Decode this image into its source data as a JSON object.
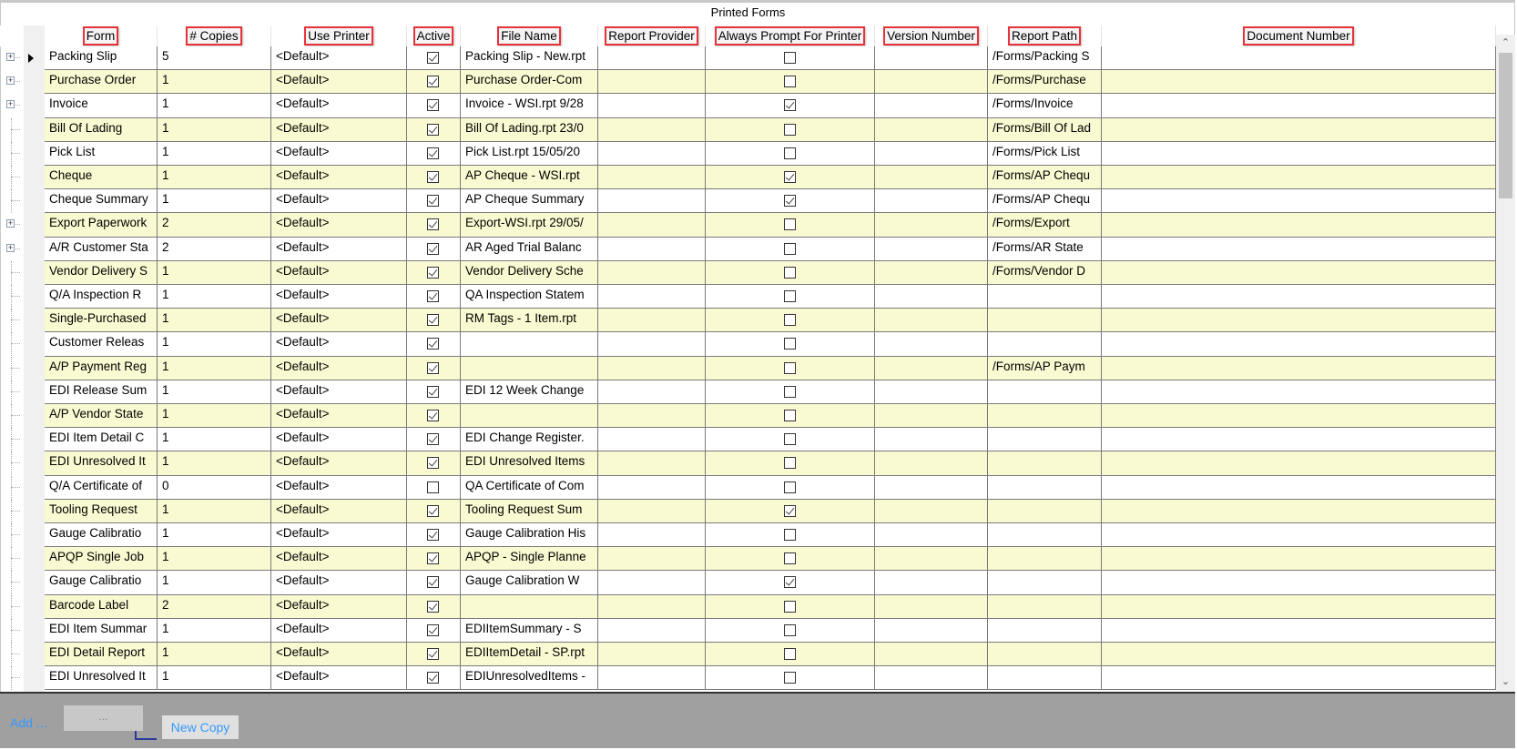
{
  "title": "Printed Forms",
  "columns": [
    "Form",
    "# Copies",
    "Use Printer",
    "Active",
    "File Name",
    "Report Provider",
    "Always Prompt For Printer",
    "Version Number",
    "Report Path",
    "Document Number"
  ],
  "colors": {
    "alt_row": "#fafad2",
    "header_highlight": "#e8323a",
    "link": "#3399ff",
    "footer": "#a0a0a0"
  },
  "rows": [
    {
      "form": "Packing Slip",
      "copies": "5",
      "printer": "<Default>",
      "active": true,
      "file": "Packing Slip - New.rpt",
      "provider": "",
      "prompt": false,
      "version": "",
      "path": "/Forms/Packing S",
      "doc": "",
      "expandable": true,
      "current": true
    },
    {
      "form": "Purchase Order",
      "copies": "1",
      "printer": "<Default>",
      "active": true,
      "file": "Purchase Order-Com",
      "provider": "",
      "prompt": false,
      "version": "",
      "path": "/Forms/Purchase",
      "doc": "",
      "expandable": true
    },
    {
      "form": "Invoice",
      "copies": "1",
      "printer": "<Default>",
      "active": true,
      "file": "Invoice - WSI.rpt 9/28",
      "provider": "",
      "prompt": true,
      "version": "",
      "path": "/Forms/Invoice",
      "doc": "",
      "expandable": true
    },
    {
      "form": "Bill Of Lading",
      "copies": "1",
      "printer": "<Default>",
      "active": true,
      "file": "Bill Of Lading.rpt 23/0",
      "provider": "",
      "prompt": false,
      "version": "",
      "path": "/Forms/Bill Of Lad",
      "doc": ""
    },
    {
      "form": "Pick List",
      "copies": "1",
      "printer": "<Default>",
      "active": true,
      "file": "Pick List.rpt 15/05/20",
      "provider": "",
      "prompt": false,
      "version": "",
      "path": "/Forms/Pick List",
      "doc": ""
    },
    {
      "form": "Cheque",
      "copies": "1",
      "printer": "<Default>",
      "active": true,
      "file": "AP Cheque - WSI.rpt",
      "provider": "",
      "prompt": true,
      "version": "",
      "path": "/Forms/AP Chequ",
      "doc": ""
    },
    {
      "form": "Cheque Summary",
      "copies": "1",
      "printer": "<Default>",
      "active": true,
      "file": "AP Cheque Summary",
      "provider": "",
      "prompt": true,
      "version": "",
      "path": "/Forms/AP Chequ",
      "doc": ""
    },
    {
      "form": "Export Paperwork",
      "copies": "2",
      "printer": "<Default>",
      "active": true,
      "file": "Export-WSI.rpt 29/05/",
      "provider": "",
      "prompt": false,
      "version": "",
      "path": "/Forms/Export",
      "doc": "",
      "expandable": true
    },
    {
      "form": "A/R Customer Sta",
      "copies": "2",
      "printer": "<Default>",
      "active": true,
      "file": "AR Aged Trial Balanc",
      "provider": "",
      "prompt": false,
      "version": "",
      "path": "/Forms/AR State",
      "doc": "",
      "expandable": true
    },
    {
      "form": "Vendor Delivery S",
      "copies": "1",
      "printer": "<Default>",
      "active": true,
      "file": "Vendor Delivery Sche",
      "provider": "",
      "prompt": false,
      "version": "",
      "path": "/Forms/Vendor D",
      "doc": ""
    },
    {
      "form": "Q/A Inspection R",
      "copies": "1",
      "printer": "<Default>",
      "active": true,
      "file": "QA Inspection Statem",
      "provider": "",
      "prompt": false,
      "version": "",
      "path": "",
      "doc": ""
    },
    {
      "form": "Single-Purchased",
      "copies": "1",
      "printer": "<Default>",
      "active": true,
      "file": "RM Tags - 1 Item.rpt",
      "provider": "",
      "prompt": false,
      "version": "",
      "path": "",
      "doc": ""
    },
    {
      "form": "Customer Releas",
      "copies": "1",
      "printer": "<Default>",
      "active": true,
      "file": "",
      "provider": "",
      "prompt": false,
      "version": "",
      "path": "",
      "doc": ""
    },
    {
      "form": "A/P Payment Reg",
      "copies": "1",
      "printer": "<Default>",
      "active": true,
      "file": "",
      "provider": "",
      "prompt": false,
      "version": "",
      "path": "/Forms/AP Paym",
      "doc": ""
    },
    {
      "form": "EDI Release Sum",
      "copies": "1",
      "printer": "<Default>",
      "active": true,
      "file": "EDI 12 Week Change",
      "provider": "",
      "prompt": false,
      "version": "",
      "path": "",
      "doc": ""
    },
    {
      "form": "A/P Vendor State",
      "copies": "1",
      "printer": "<Default>",
      "active": true,
      "file": "",
      "provider": "",
      "prompt": false,
      "version": "",
      "path": "",
      "doc": ""
    },
    {
      "form": "EDI Item Detail C",
      "copies": "1",
      "printer": "<Default>",
      "active": true,
      "file": "EDI Change Register.",
      "provider": "",
      "prompt": false,
      "version": "",
      "path": "",
      "doc": ""
    },
    {
      "form": "EDI Unresolved It",
      "copies": "1",
      "printer": "<Default>",
      "active": true,
      "file": "EDI Unresolved Items",
      "provider": "",
      "prompt": false,
      "version": "",
      "path": "",
      "doc": ""
    },
    {
      "form": "Q/A Certificate of",
      "copies": "0",
      "printer": "<Default>",
      "active": false,
      "file": "QA Certificate of Com",
      "provider": "",
      "prompt": false,
      "version": "",
      "path": "",
      "doc": ""
    },
    {
      "form": "Tooling Request",
      "copies": "1",
      "printer": "<Default>",
      "active": true,
      "file": "Tooling Request Sum",
      "provider": "",
      "prompt": true,
      "version": "",
      "path": "",
      "doc": ""
    },
    {
      "form": "Gauge Calibratio",
      "copies": "1",
      "printer": "<Default>",
      "active": true,
      "file": "Gauge Calibration His",
      "provider": "",
      "prompt": false,
      "version": "",
      "path": "",
      "doc": ""
    },
    {
      "form": "APQP Single Job",
      "copies": "1",
      "printer": "<Default>",
      "active": true,
      "file": "APQP - Single Planne",
      "provider": "",
      "prompt": false,
      "version": "",
      "path": "",
      "doc": ""
    },
    {
      "form": "Gauge Calibratio",
      "copies": "1",
      "printer": "<Default>",
      "active": true,
      "file": "Gauge Calibration W",
      "provider": "",
      "prompt": true,
      "version": "",
      "path": "",
      "doc": ""
    },
    {
      "form": "Barcode Label",
      "copies": "2",
      "printer": "<Default>",
      "active": true,
      "file": "",
      "provider": "",
      "prompt": false,
      "version": "",
      "path": "",
      "doc": ""
    },
    {
      "form": "EDI Item Summar",
      "copies": "1",
      "printer": "<Default>",
      "active": true,
      "file": "EDIItemSummary - S",
      "provider": "",
      "prompt": false,
      "version": "",
      "path": "",
      "doc": ""
    },
    {
      "form": "EDI Detail Report",
      "copies": "1",
      "printer": "<Default>",
      "active": true,
      "file": "EDIItemDetail - SP.rpt",
      "provider": "",
      "prompt": false,
      "version": "",
      "path": "",
      "doc": ""
    },
    {
      "form": "EDI Unresolved It",
      "copies": "1",
      "printer": "<Default>",
      "active": true,
      "file": "EDIUnresolvedItems -",
      "provider": "",
      "prompt": false,
      "version": "",
      "path": "",
      "doc": ""
    }
  ],
  "footer": {
    "add_label": "Add ...",
    "ellipsis_label": "...",
    "new_copy_label": "New Copy"
  }
}
